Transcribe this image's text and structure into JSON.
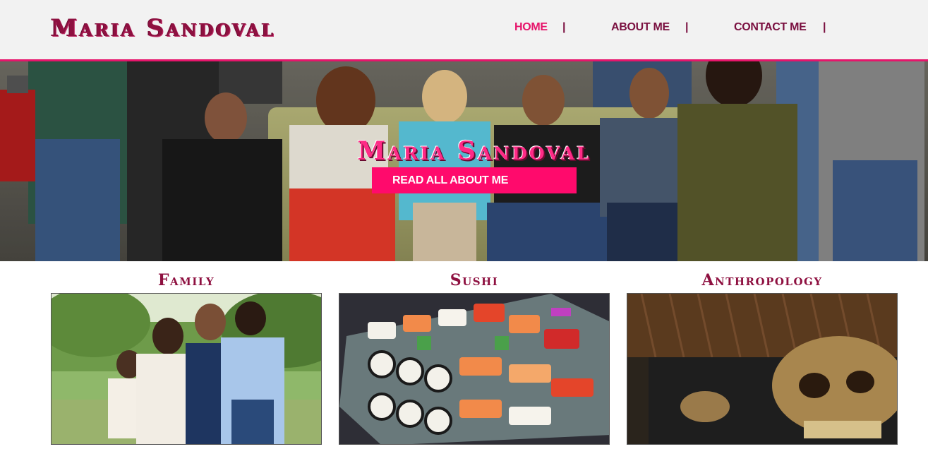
{
  "header": {
    "logo_text": "Maria Sandoval",
    "nav": [
      {
        "label": "HOME",
        "active": true
      },
      {
        "label": "ABOUT ME",
        "active": false
      },
      {
        "label": "CONTACT ME",
        "active": false
      }
    ],
    "separator": "|"
  },
  "hero": {
    "title": "Maria Sandoval",
    "button_label": "READ ALL ABOUT ME",
    "image_description": "group photo of people on a couch"
  },
  "cards": [
    {
      "title": "Family",
      "image_description": "family portrait in park"
    },
    {
      "title": "Sushi",
      "image_description": "platter of assorted sushi"
    },
    {
      "title": "Anthropology",
      "image_description": "ancient skull artifact"
    }
  ],
  "colors": {
    "accent": "#e6156b",
    "brand_dark": "#8e1040",
    "header_bg": "#f2f2f2",
    "button_bg": "#ff0a6c"
  }
}
